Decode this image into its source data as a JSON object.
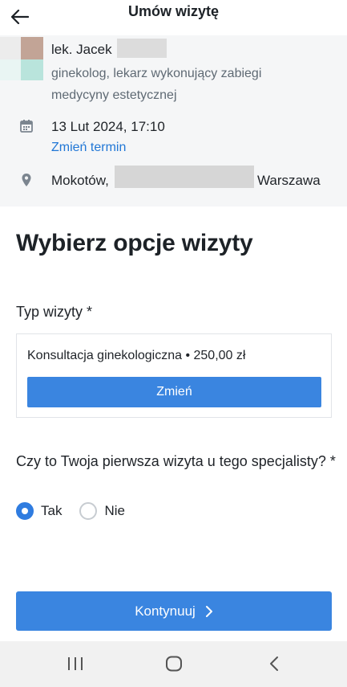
{
  "header": {
    "title": "Umów wizytę",
    "back_icon": "arrow-left-icon"
  },
  "doctor": {
    "name": "lek. Jacek",
    "specialization": "ginekolog, lekarz wykonujący zabiegi medycyny estetycznej"
  },
  "appointment": {
    "date_icon": "calendar-icon",
    "datetime": "13 Lut 2024, 17:10",
    "change_date_label": "Zmień termin",
    "location_icon": "map-pin-icon",
    "address_part1": "Mokotów,",
    "address_part2": "Warszawa"
  },
  "main": {
    "heading": "Wybierz opcje wizyty",
    "visit_type_label": "Typ wizyty *",
    "visit_type_value": "Konsultacja ginekologiczna • 250,00 zł",
    "change_button_label": "Zmień",
    "first_visit_question": "Czy to Twoja pierwsza wizyta u tego specjalisty? *",
    "first_visit_options": [
      {
        "label": "Tak",
        "checked": true
      },
      {
        "label": "Nie",
        "checked": false
      }
    ],
    "continue_label": "Kontynuuj"
  },
  "navbar": {
    "recents_icon": "recent-apps-icon",
    "home_icon": "home-icon",
    "back_icon": "nav-back-icon"
  },
  "colors": {
    "accent": "#3a85e0",
    "link": "#2177d6",
    "summary_bg": "#f5f6f7"
  }
}
